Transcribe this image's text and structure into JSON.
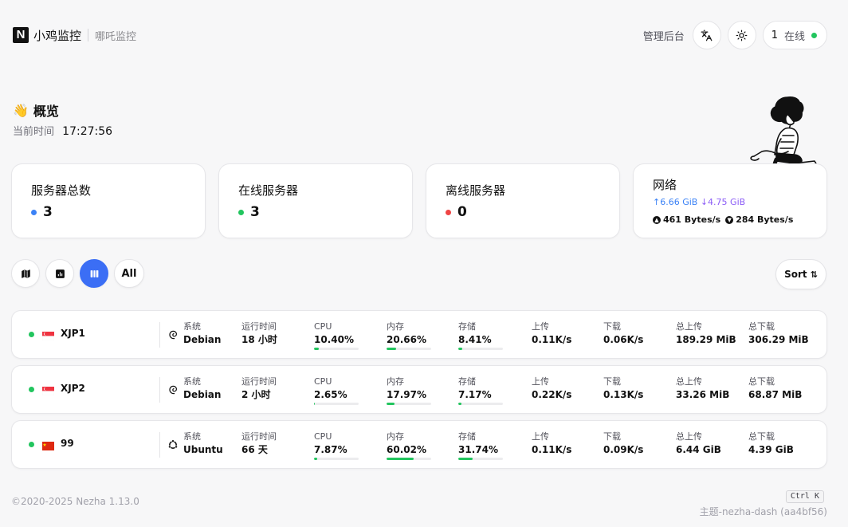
{
  "header": {
    "logo_letter": "N",
    "title": "小鸡监控",
    "subtitle": "哪吒监控",
    "admin_link": "管理后台",
    "translate_icon": "translate-icon",
    "theme_icon": "sun-icon",
    "online_count": "1",
    "online_label": "在线",
    "online_color": "#22c55e"
  },
  "overview": {
    "title": "概览",
    "title_icon": "waving-hand-icon",
    "time_label": "当前时间",
    "time_value": "17:27:56"
  },
  "stats": {
    "total": {
      "label": "服务器总数",
      "value": "3",
      "color": "#3b82f6"
    },
    "online": {
      "label": "在线服务器",
      "value": "3",
      "color": "#22c55e"
    },
    "offline": {
      "label": "离线服务器",
      "value": "0",
      "color": "#ef4444"
    },
    "network": {
      "label": "网络",
      "upload_total": "↑6.66 GiB",
      "download_total": "↓4.75 GiB",
      "upload_speed": "461 Bytes/s",
      "download_speed": "284 Bytes/s"
    }
  },
  "toolbar": {
    "buttons": [
      "map-icon",
      "chart-icon",
      "columns-icon"
    ],
    "active_index": 2,
    "group_filter": "All",
    "sort_label": "Sort",
    "accent_color": "#3b6ef5"
  },
  "columns": {
    "os": "系统",
    "uptime": "运行时间",
    "cpu": "CPU",
    "mem": "内存",
    "disk": "存储",
    "up": "上传",
    "down": "下载",
    "total_up": "总上传",
    "total_down": "总下载"
  },
  "servers": [
    {
      "name": "XJP1",
      "flag": "singapore-flag",
      "os": "Debian",
      "os_icon": "debian-icon",
      "uptime": "18 小时",
      "cpu": "10.40%",
      "cpu_pct": 10.4,
      "mem": "20.66%",
      "mem_pct": 20.66,
      "disk": "8.41%",
      "disk_pct": 8.41,
      "up": "0.11K/s",
      "down": "0.06K/s",
      "total_up": "189.29 MiB",
      "total_down": "306.29 MiB"
    },
    {
      "name": "XJP2",
      "flag": "singapore-flag",
      "os": "Debian",
      "os_icon": "debian-icon",
      "uptime": "2 小时",
      "cpu": "2.65%",
      "cpu_pct": 2.65,
      "mem": "17.97%",
      "mem_pct": 17.97,
      "disk": "7.17%",
      "disk_pct": 7.17,
      "up": "0.22K/s",
      "down": "0.13K/s",
      "total_up": "33.26 MiB",
      "total_down": "68.87 MiB"
    },
    {
      "name": "99",
      "flag": "china-flag",
      "os": "Ubuntu",
      "os_icon": "ubuntu-icon",
      "uptime": "66 天",
      "cpu": "7.87%",
      "cpu_pct": 7.87,
      "mem": "60.02%",
      "mem_pct": 60.02,
      "disk": "31.74%",
      "disk_pct": 31.74,
      "up": "0.11K/s",
      "down": "0.09K/s",
      "total_up": "6.44 GiB",
      "total_down": "4.39 GiB"
    }
  ],
  "footer": {
    "copyright": "©2020-2025 Nezha 1.13.0",
    "shortcut": "Ctrl K",
    "theme": "主题-nezha-dash (aa4bf56)"
  }
}
